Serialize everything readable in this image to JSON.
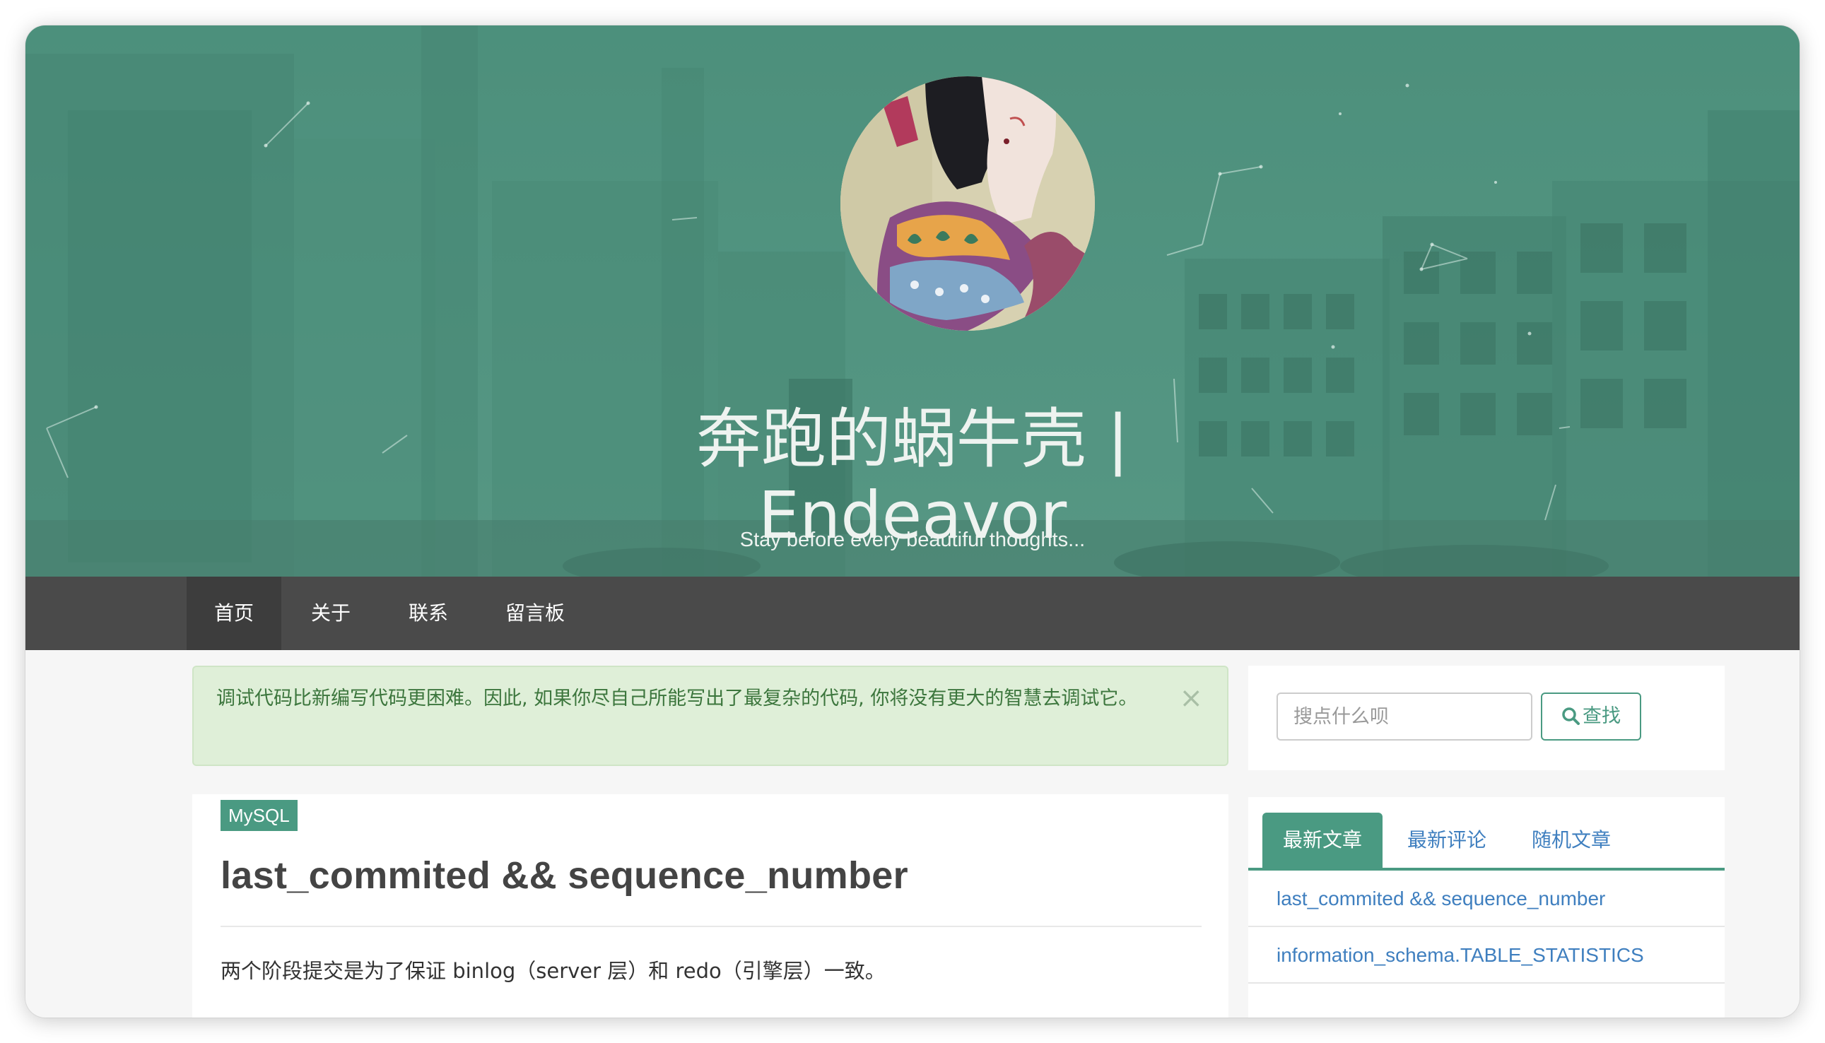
{
  "site": {
    "title_line1": "奔跑的蜗牛壳 |",
    "title_line2": "Endeavor",
    "subtitle": "Stay before every beautiful thoughts..."
  },
  "nav": {
    "items": [
      {
        "label": "首页",
        "active": true
      },
      {
        "label": "关于",
        "active": false
      },
      {
        "label": "联系",
        "active": false
      },
      {
        "label": "留言板",
        "active": false
      }
    ]
  },
  "alert": {
    "text": "调试代码比新编写代码更困难。因此, 如果你尽自己所能写出了最复杂的代码, 你将没有更大的智慧去调试它。",
    "close_label": "×"
  },
  "post": {
    "tag": "MySQL",
    "title": "last_commited && sequence_number",
    "excerpt": "两个阶段提交是为了保证 binlog（server 层）和 redo（引擎层）一致。"
  },
  "search": {
    "placeholder": "搜点什么呗",
    "button_label": "查找",
    "button_icon": "search-icon"
  },
  "sidebar_tabs": {
    "tabs": [
      {
        "label": "最新文章",
        "active": true
      },
      {
        "label": "最新评论",
        "active": false
      },
      {
        "label": "随机文章",
        "active": false
      }
    ],
    "items": [
      "last_commited && sequence_number",
      "information_schema.TABLE_STATISTICS"
    ]
  },
  "colors": {
    "banner": "#4b8a78",
    "accent": "#4a9a82",
    "nav_bg": "#4a4a4a",
    "link": "#3f7fbf",
    "alert_bg": "#dfefd8",
    "alert_text": "#3c763d"
  }
}
